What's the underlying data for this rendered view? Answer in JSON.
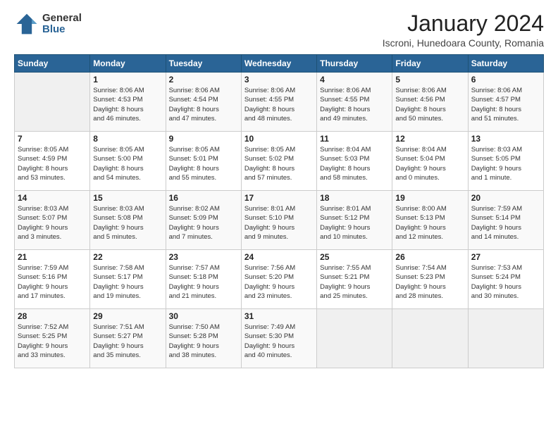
{
  "logo": {
    "general": "General",
    "blue": "Blue"
  },
  "title": "January 2024",
  "location": "Iscroni, Hunedoara County, Romania",
  "days_header": [
    "Sunday",
    "Monday",
    "Tuesday",
    "Wednesday",
    "Thursday",
    "Friday",
    "Saturday"
  ],
  "weeks": [
    [
      {
        "day": "",
        "info": ""
      },
      {
        "day": "1",
        "info": "Sunrise: 8:06 AM\nSunset: 4:53 PM\nDaylight: 8 hours\nand 46 minutes."
      },
      {
        "day": "2",
        "info": "Sunrise: 8:06 AM\nSunset: 4:54 PM\nDaylight: 8 hours\nand 47 minutes."
      },
      {
        "day": "3",
        "info": "Sunrise: 8:06 AM\nSunset: 4:55 PM\nDaylight: 8 hours\nand 48 minutes."
      },
      {
        "day": "4",
        "info": "Sunrise: 8:06 AM\nSunset: 4:55 PM\nDaylight: 8 hours\nand 49 minutes."
      },
      {
        "day": "5",
        "info": "Sunrise: 8:06 AM\nSunset: 4:56 PM\nDaylight: 8 hours\nand 50 minutes."
      },
      {
        "day": "6",
        "info": "Sunrise: 8:06 AM\nSunset: 4:57 PM\nDaylight: 8 hours\nand 51 minutes."
      }
    ],
    [
      {
        "day": "7",
        "info": "Sunrise: 8:05 AM\nSunset: 4:59 PM\nDaylight: 8 hours\nand 53 minutes."
      },
      {
        "day": "8",
        "info": "Sunrise: 8:05 AM\nSunset: 5:00 PM\nDaylight: 8 hours\nand 54 minutes."
      },
      {
        "day": "9",
        "info": "Sunrise: 8:05 AM\nSunset: 5:01 PM\nDaylight: 8 hours\nand 55 minutes."
      },
      {
        "day": "10",
        "info": "Sunrise: 8:05 AM\nSunset: 5:02 PM\nDaylight: 8 hours\nand 57 minutes."
      },
      {
        "day": "11",
        "info": "Sunrise: 8:04 AM\nSunset: 5:03 PM\nDaylight: 8 hours\nand 58 minutes."
      },
      {
        "day": "12",
        "info": "Sunrise: 8:04 AM\nSunset: 5:04 PM\nDaylight: 9 hours\nand 0 minutes."
      },
      {
        "day": "13",
        "info": "Sunrise: 8:03 AM\nSunset: 5:05 PM\nDaylight: 9 hours\nand 1 minute."
      }
    ],
    [
      {
        "day": "14",
        "info": "Sunrise: 8:03 AM\nSunset: 5:07 PM\nDaylight: 9 hours\nand 3 minutes."
      },
      {
        "day": "15",
        "info": "Sunrise: 8:03 AM\nSunset: 5:08 PM\nDaylight: 9 hours\nand 5 minutes."
      },
      {
        "day": "16",
        "info": "Sunrise: 8:02 AM\nSunset: 5:09 PM\nDaylight: 9 hours\nand 7 minutes."
      },
      {
        "day": "17",
        "info": "Sunrise: 8:01 AM\nSunset: 5:10 PM\nDaylight: 9 hours\nand 9 minutes."
      },
      {
        "day": "18",
        "info": "Sunrise: 8:01 AM\nSunset: 5:12 PM\nDaylight: 9 hours\nand 10 minutes."
      },
      {
        "day": "19",
        "info": "Sunrise: 8:00 AM\nSunset: 5:13 PM\nDaylight: 9 hours\nand 12 minutes."
      },
      {
        "day": "20",
        "info": "Sunrise: 7:59 AM\nSunset: 5:14 PM\nDaylight: 9 hours\nand 14 minutes."
      }
    ],
    [
      {
        "day": "21",
        "info": "Sunrise: 7:59 AM\nSunset: 5:16 PM\nDaylight: 9 hours\nand 17 minutes."
      },
      {
        "day": "22",
        "info": "Sunrise: 7:58 AM\nSunset: 5:17 PM\nDaylight: 9 hours\nand 19 minutes."
      },
      {
        "day": "23",
        "info": "Sunrise: 7:57 AM\nSunset: 5:18 PM\nDaylight: 9 hours\nand 21 minutes."
      },
      {
        "day": "24",
        "info": "Sunrise: 7:56 AM\nSunset: 5:20 PM\nDaylight: 9 hours\nand 23 minutes."
      },
      {
        "day": "25",
        "info": "Sunrise: 7:55 AM\nSunset: 5:21 PM\nDaylight: 9 hours\nand 25 minutes."
      },
      {
        "day": "26",
        "info": "Sunrise: 7:54 AM\nSunset: 5:23 PM\nDaylight: 9 hours\nand 28 minutes."
      },
      {
        "day": "27",
        "info": "Sunrise: 7:53 AM\nSunset: 5:24 PM\nDaylight: 9 hours\nand 30 minutes."
      }
    ],
    [
      {
        "day": "28",
        "info": "Sunrise: 7:52 AM\nSunset: 5:25 PM\nDaylight: 9 hours\nand 33 minutes."
      },
      {
        "day": "29",
        "info": "Sunrise: 7:51 AM\nSunset: 5:27 PM\nDaylight: 9 hours\nand 35 minutes."
      },
      {
        "day": "30",
        "info": "Sunrise: 7:50 AM\nSunset: 5:28 PM\nDaylight: 9 hours\nand 38 minutes."
      },
      {
        "day": "31",
        "info": "Sunrise: 7:49 AM\nSunset: 5:30 PM\nDaylight: 9 hours\nand 40 minutes."
      },
      {
        "day": "",
        "info": ""
      },
      {
        "day": "",
        "info": ""
      },
      {
        "day": "",
        "info": ""
      }
    ]
  ]
}
